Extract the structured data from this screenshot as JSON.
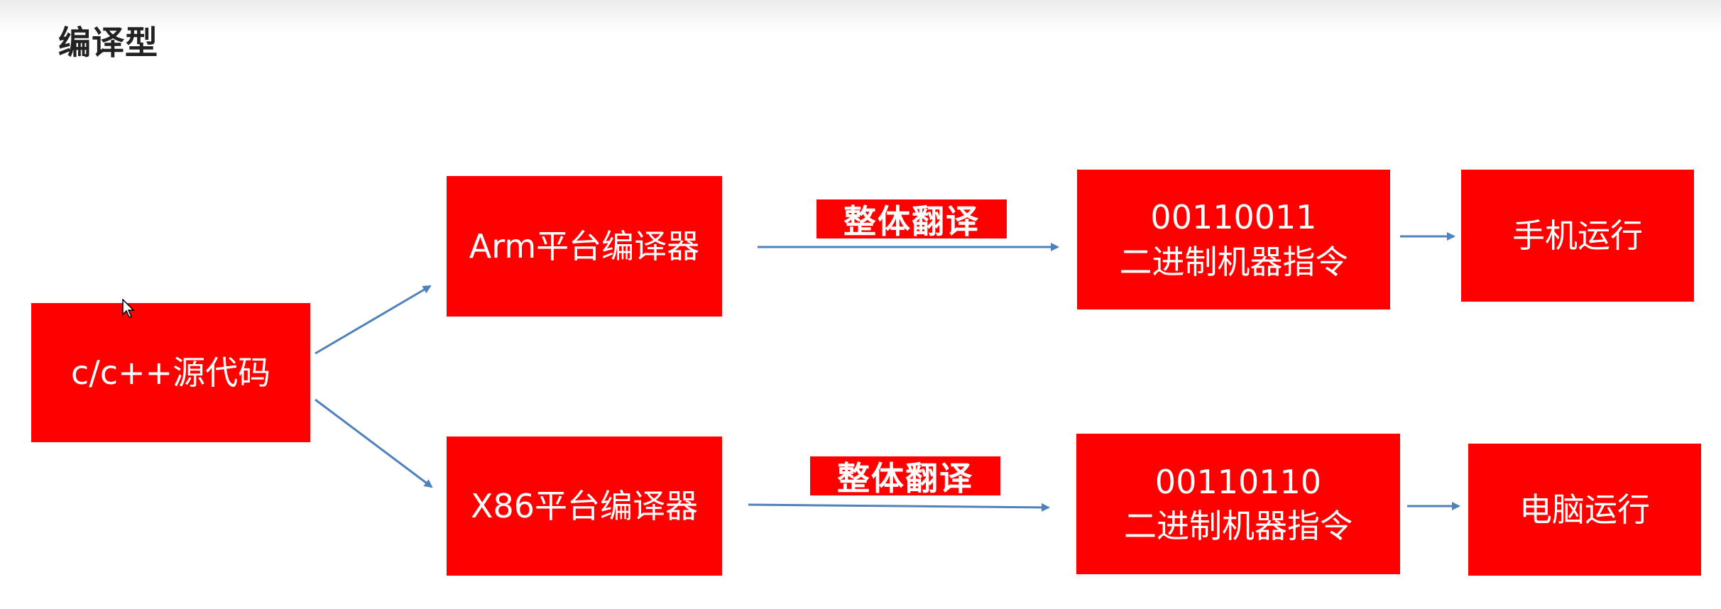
{
  "page": {
    "title": "编译型"
  },
  "diagram": {
    "source": {
      "label": "c/c++源代码"
    },
    "compilers": {
      "arm": "Arm平台编译器",
      "x86": "X86平台编译器"
    },
    "edge_labels": {
      "top": "整体翻译",
      "bottom": "整体翻译"
    },
    "outputs": {
      "arm": {
        "binary": "00110011",
        "caption": "二进制机器指令"
      },
      "x86": {
        "binary": "00110110",
        "caption": "二进制机器指令"
      }
    },
    "runtimes": {
      "arm": "手机运行",
      "x86": "电脑运行"
    },
    "colors": {
      "box_fill": "#ff0000",
      "box_text": "#ffffff",
      "arrow": "#4f81bd",
      "title_text": "#222222"
    }
  }
}
